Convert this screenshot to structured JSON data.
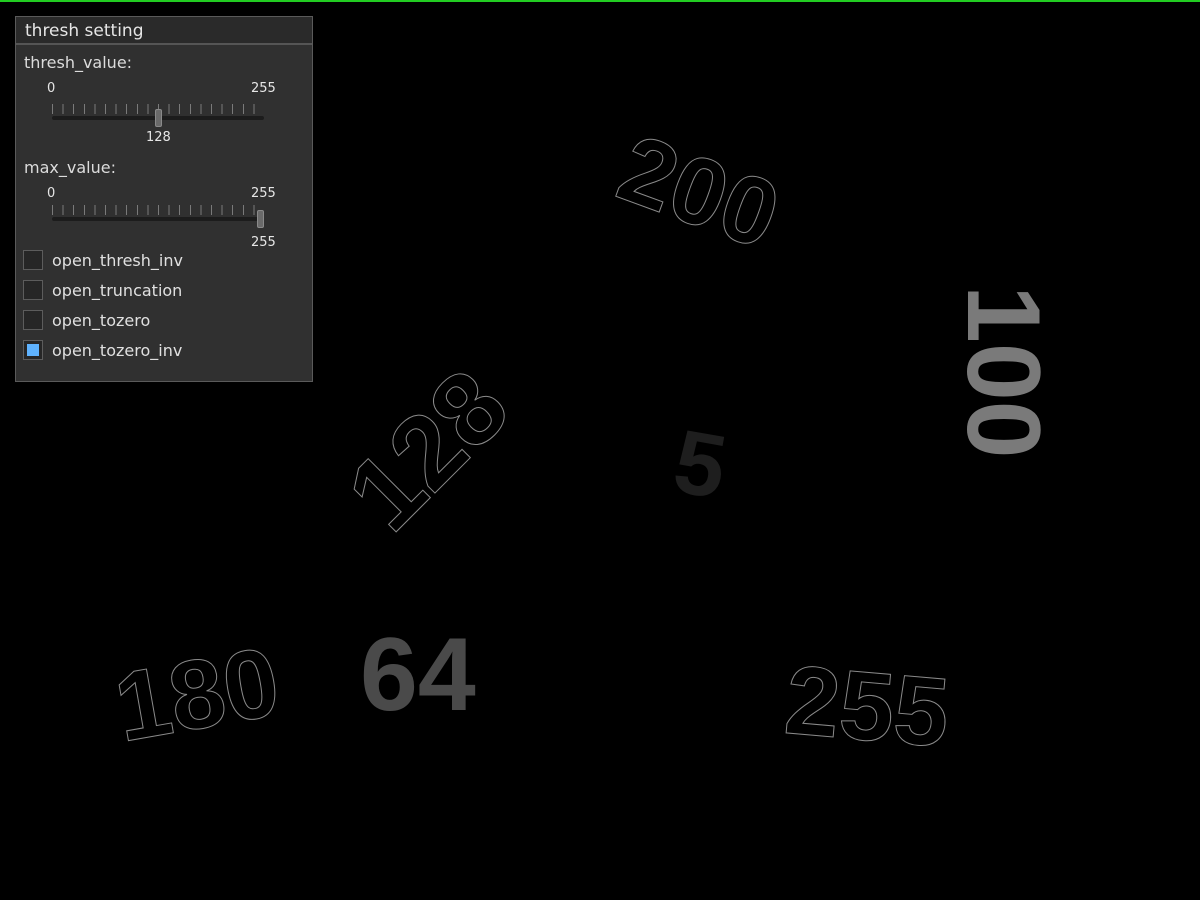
{
  "panel": {
    "title": "thresh setting",
    "thresh": {
      "label": "thresh_value:",
      "min": "0",
      "max": "255",
      "value_text": "128",
      "value": 128
    },
    "max_value": {
      "label": "max_value:",
      "min": "0",
      "max": "255",
      "value_text": "255",
      "value": 255
    },
    "options": [
      {
        "label": "open_thresh_inv",
        "checked": false
      },
      {
        "label": "open_truncation",
        "checked": false
      },
      {
        "label": "open_tozero",
        "checked": false
      },
      {
        "label": "open_tozero_inv",
        "checked": true
      }
    ]
  },
  "canvas": {
    "numbers": [
      "200",
      "100",
      "128",
      "5",
      "180",
      "64",
      "255"
    ],
    "colors": {
      "filled_100": "#7a7a7a",
      "filled_64": "#4a4a4a",
      "faint_5": "#1e1e1e",
      "outline": "#8a8a8a",
      "checkbox_accent": "#5fb3ff",
      "top_border": "#22cc22"
    }
  }
}
